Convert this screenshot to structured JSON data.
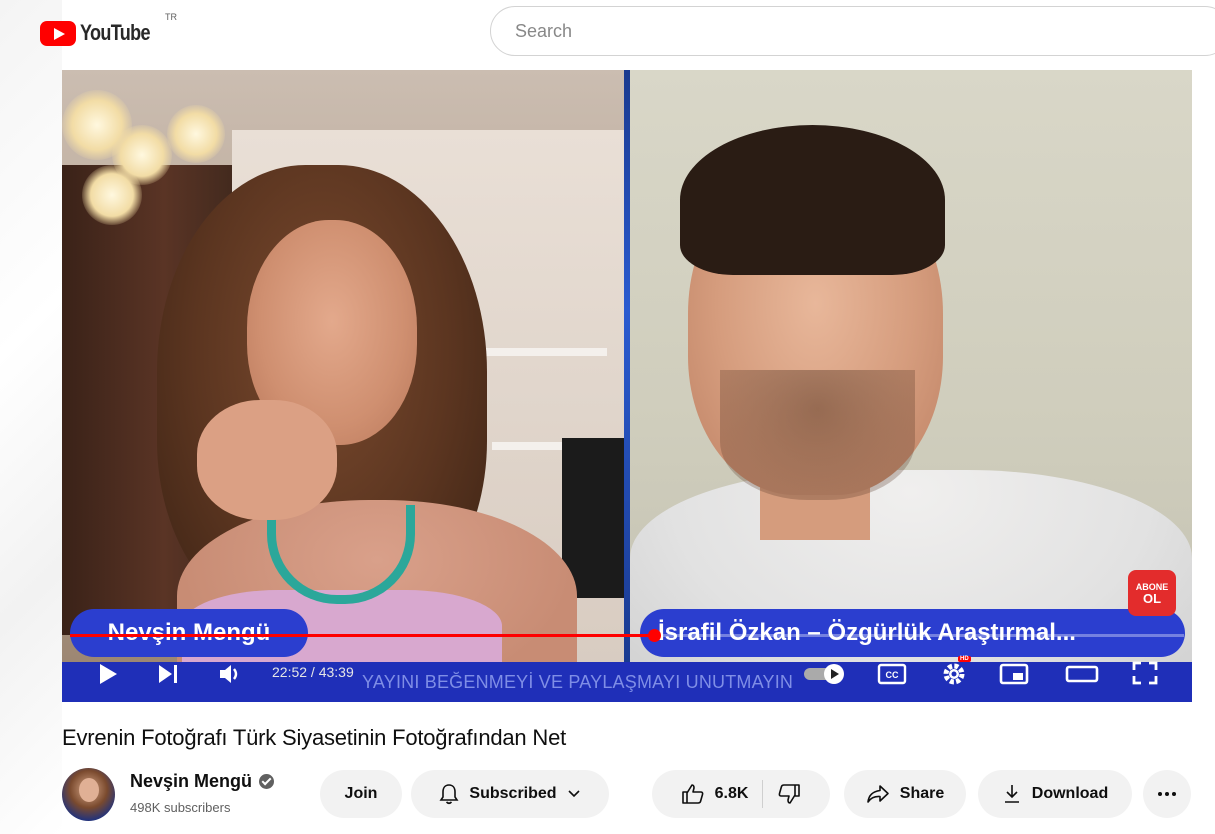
{
  "header": {
    "logo_text": "YouTube",
    "region_code": "TR",
    "search": {
      "placeholder": "Search",
      "value": ""
    }
  },
  "video": {
    "overlay": {
      "left_name": "Nevşin Mengü",
      "right_name": "İsrafil Özkan – Özgürlük Araştırmal...",
      "banner_text": "YAYINI BEĞENMEYİ VE PAYLAŞMAYI UNUTMAYIN",
      "subscribe_badge_line1": "ABONE",
      "subscribe_badge_line2": "OL"
    },
    "player": {
      "current_time": "22:52",
      "duration": "43:39",
      "time_separator": " / ",
      "progress_fraction": 0.524,
      "settings_badge": "HD",
      "icons": {
        "play": "play-icon",
        "next": "next-icon",
        "volume": "volume-icon",
        "autoplay": "autoplay-toggle-icon",
        "captions": "captions-icon",
        "settings": "gear-icon",
        "miniplayer": "miniplayer-icon",
        "theater": "theater-icon",
        "fullscreen": "fullscreen-icon"
      }
    }
  },
  "meta": {
    "title": "Evrenin Fotoğrafı Türk Siyasetinin Fotoğrafından Net",
    "channel": {
      "name": "Nevşin Mengü",
      "subscribers": "498K subscribers",
      "verified": true
    },
    "buttons": {
      "join": "Join",
      "subscribed": "Subscribed",
      "likes": "6.8K",
      "share": "Share",
      "download": "Download"
    }
  },
  "colors": {
    "brand_red": "#ff0000",
    "overlay_blue": "#2b3ecf",
    "pill_bg": "#f2f2f2"
  }
}
